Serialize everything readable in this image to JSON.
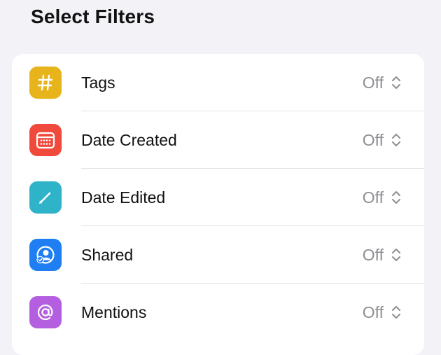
{
  "page": {
    "title": "Select Filters"
  },
  "filters": [
    {
      "label": "Tags",
      "value": "Off",
      "icon": "hashtag-icon",
      "color": "#e8b41c"
    },
    {
      "label": "Date Created",
      "value": "Off",
      "icon": "calendar-icon",
      "color": "#f04a3c"
    },
    {
      "label": "Date Edited",
      "value": "Off",
      "icon": "pencil-icon",
      "color": "#2fb3c9"
    },
    {
      "label": "Shared",
      "value": "Off",
      "icon": "shared-person-icon",
      "color": "#1f7ef1"
    },
    {
      "label": "Mentions",
      "value": "Off",
      "icon": "at-sign-icon",
      "color": "#b45ee0"
    }
  ]
}
